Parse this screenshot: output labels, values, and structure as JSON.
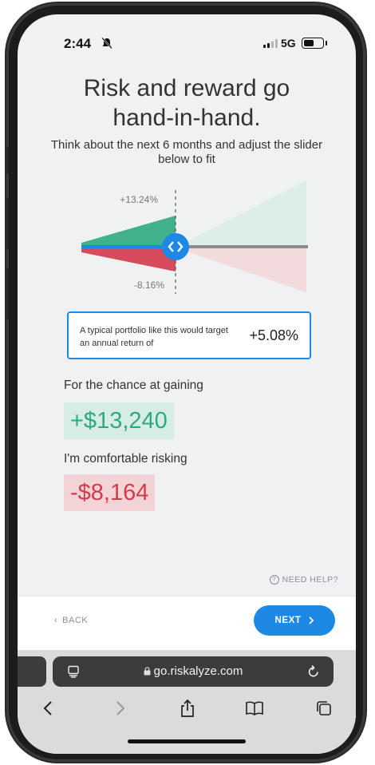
{
  "status_bar": {
    "time": "2:44",
    "network": "5G"
  },
  "page": {
    "title_line1": "Risk and reward go",
    "title_line2": "hand-in-hand.",
    "subtitle": "Think about the next 6 months and adjust the slider below to fit"
  },
  "slider": {
    "upper_label": "+13.24%",
    "lower_label": "-8.16%",
    "position": 0.4,
    "colors": {
      "gain": "#2eaa82",
      "loss": "#d33a4b",
      "track": "#1e88e5",
      "knob": "#1e88e5"
    }
  },
  "portfolio": {
    "text": "A typical portfolio like this would target an annual return of",
    "value": "+5.08%"
  },
  "outcome": {
    "gain_label": "For the chance at gaining",
    "gain_value": "+$13,240",
    "loss_label": "I'm comfortable risking",
    "loss_value": "-$8,164"
  },
  "help": {
    "label": "NEED HELP?",
    "icon": "question-circle-icon"
  },
  "nav": {
    "back_label": "BACK",
    "next_label": "NEXT"
  },
  "browser": {
    "url": "go.riskalyze.com",
    "icons": [
      "back-icon",
      "forward-icon",
      "share-icon",
      "bookmarks-icon",
      "tabs-icon"
    ]
  }
}
